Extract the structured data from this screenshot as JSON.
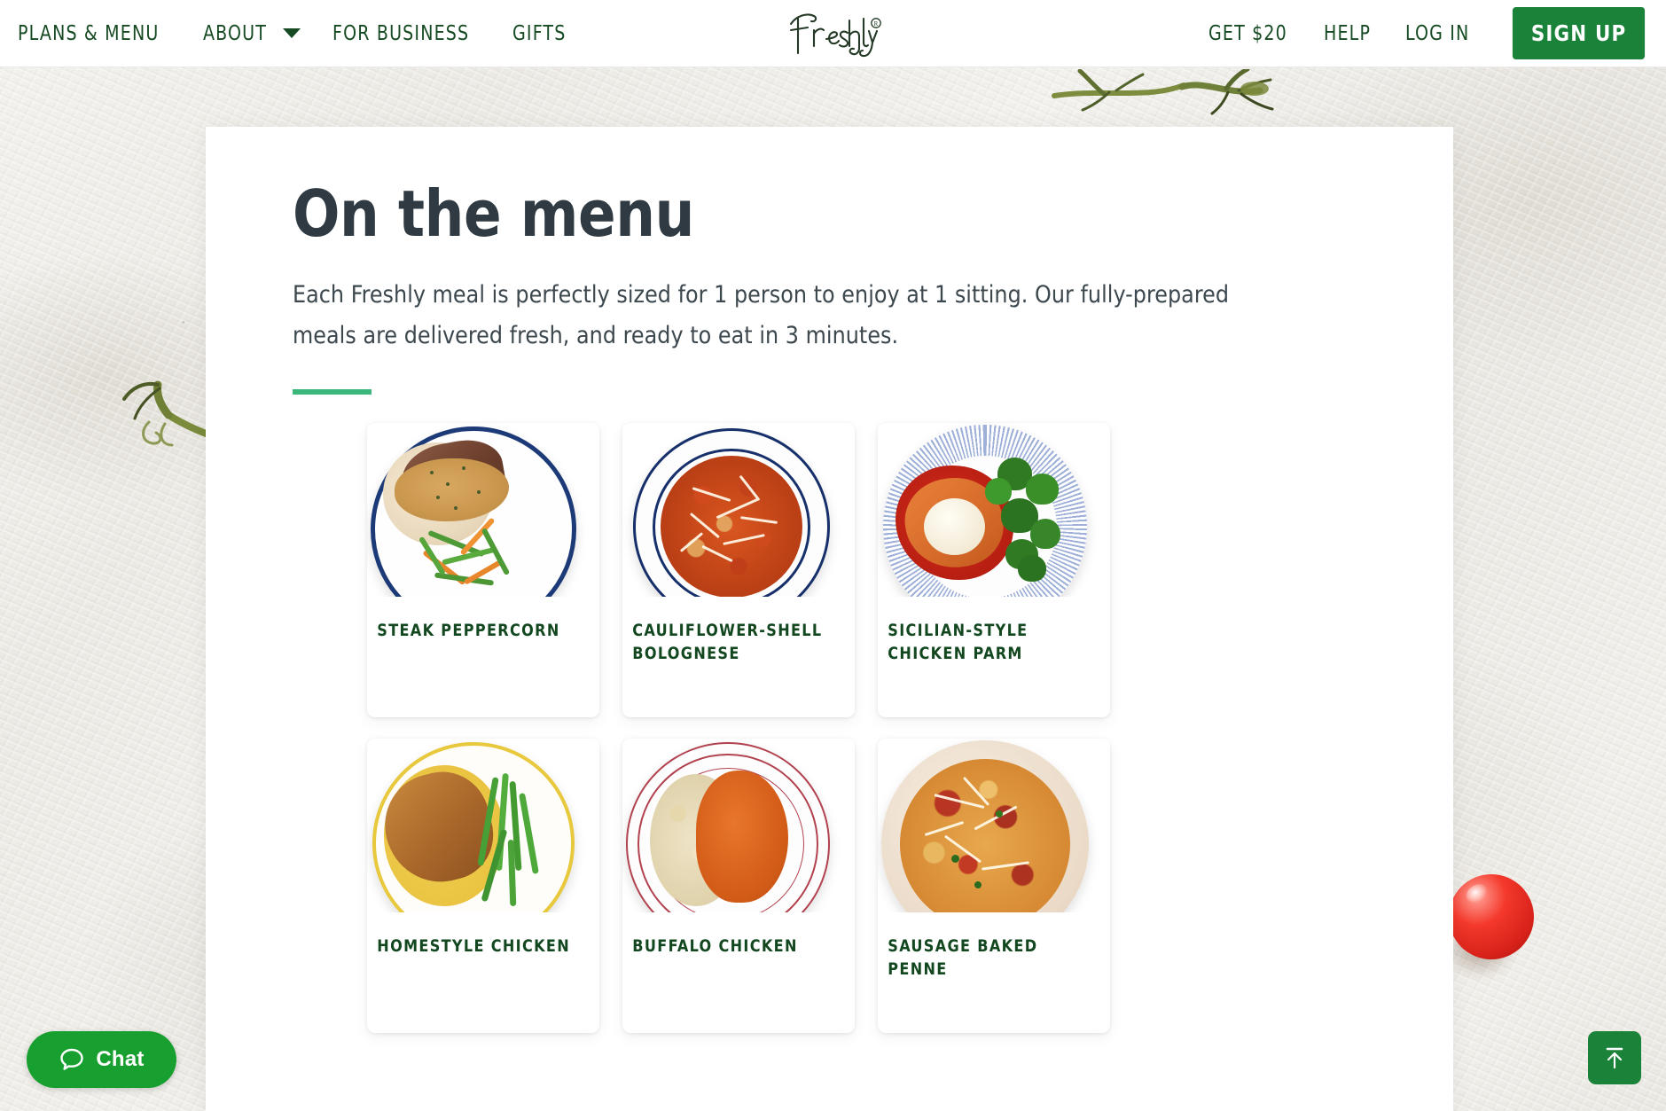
{
  "header": {
    "nav_left": [
      {
        "label": "PLANS & MENU",
        "name": "nav-plans-menu",
        "has_caret": false
      },
      {
        "label": "ABOUT",
        "name": "nav-about",
        "has_caret": true
      },
      {
        "label": "FOR BUSINESS",
        "name": "nav-for-business",
        "has_caret": false
      },
      {
        "label": "GIFTS",
        "name": "nav-gifts",
        "has_caret": false
      }
    ],
    "logo": {
      "text": "Freshly",
      "trademark": "®",
      "icon": "freshly-script-logo"
    },
    "nav_right": [
      {
        "label": "GET $20",
        "name": "nav-get-20"
      },
      {
        "label": "HELP",
        "name": "nav-help"
      },
      {
        "label": "LOG IN",
        "name": "nav-log-in"
      }
    ],
    "signup_label": "SIGN UP",
    "caret_icon": "chevron-down-icon"
  },
  "main": {
    "title": "On the menu",
    "subtitle": "Each Freshly meal is perfectly sized for 1 person to enjoy at 1 sitting. Our fully-prepared meals are delivered fresh, and ready to eat in 3 minutes.",
    "meals": [
      {
        "name": "STEAK PEPPERCORN",
        "photo": "steak-peppercorn-photo"
      },
      {
        "name": "CAULIFLOWER-SHELL BOLOGNESE",
        "photo": "cauliflower-shell-bolognese-photo"
      },
      {
        "name": "SICILIAN-STYLE CHICKEN PARM",
        "photo": "sicilian-style-chicken-parm-photo"
      },
      {
        "name": "HOMESTYLE CHICKEN",
        "photo": "homestyle-chicken-photo"
      },
      {
        "name": "BUFFALO CHICKEN",
        "photo": "buffalo-chicken-photo"
      },
      {
        "name": "SAUSAGE BAKED PENNE",
        "photo": "sausage-baked-penne-photo"
      }
    ]
  },
  "widgets": {
    "chat_label": "Chat",
    "chat_icon": "speech-bubble-icon",
    "scroll_top_icon": "arrow-up-to-bar-icon"
  },
  "colors": {
    "brand_green": "#1a8239",
    "nav_green": "#154a22",
    "accent_green": "#3cb77b",
    "chat_green": "#17a02f",
    "title_slate": "#2f3a42",
    "meal_label_green": "#12471f",
    "panel_white": "#ffffff"
  }
}
